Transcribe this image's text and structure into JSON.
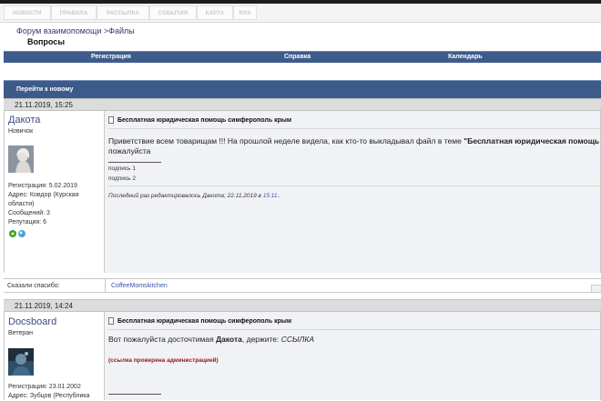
{
  "nav": {
    "items": [
      "НОВОСТИ",
      "ПРАВИЛА",
      "РАССЫЛКА",
      "СОБЫТИЯ",
      "КАРТА",
      "RSS"
    ]
  },
  "breadcrumb": "Форум взаимопомощи >Файлы",
  "section_title": "Вопросы",
  "menu": {
    "registration": "Регистрация",
    "help": "Справка",
    "calendar": "Календарь"
  },
  "jump_label": "Перейти к новому",
  "posts": [
    {
      "date": "21.11.2019, 15:25",
      "username": "Дакота",
      "rank": "Новичок",
      "info": [
        "Регистрация: 5.02.2019",
        "Адрес: Ковдор (Курская",
        "области)",
        "Сообщений: 3",
        "Репутация: 6"
      ],
      "title": "Бесплатная юридическая помощь симферополь крым",
      "text_before": "Приветствие всем товарищам !!! На прошлой неделе видела, как кто-то выкладывал файл в теме ",
      "text_bold": "\"Бесплатная юридическая помощь",
      "text_line2": "пожалуйста",
      "sig1": "подпись 1",
      "sig2": "подпись 2",
      "edit_prefix": "Последний раз редактировалось Дакота; 22.11.2019 в ",
      "edit_time": "15:11",
      "edit_suffix": ".."
    },
    {
      "date": "21.11.2019, 14:24",
      "username": "Docsboard",
      "rank": "Ветеран",
      "info": [
        "Регистрация: 23.01.2002",
        "Адрес: Зубцов (Республика"
      ],
      "title": "Бесплатная юридическая помощь симферополь крым",
      "text_before": "Вот пожалуйста досточтимая ",
      "text_bold": "Дакота",
      "text_after": ", держите: ",
      "text_italic": "ССЫЛКА",
      "checked": "(ссылка проверена администрацией)"
    }
  ],
  "thanks": {
    "label": "Сказали спасибо:",
    "user": "CoffeeMomskitchen"
  },
  "colors": {
    "menubar": "#3d5c8c",
    "username": "#3e4a86",
    "link": "#3a55a6",
    "admin_check": "#8a1a1a"
  }
}
